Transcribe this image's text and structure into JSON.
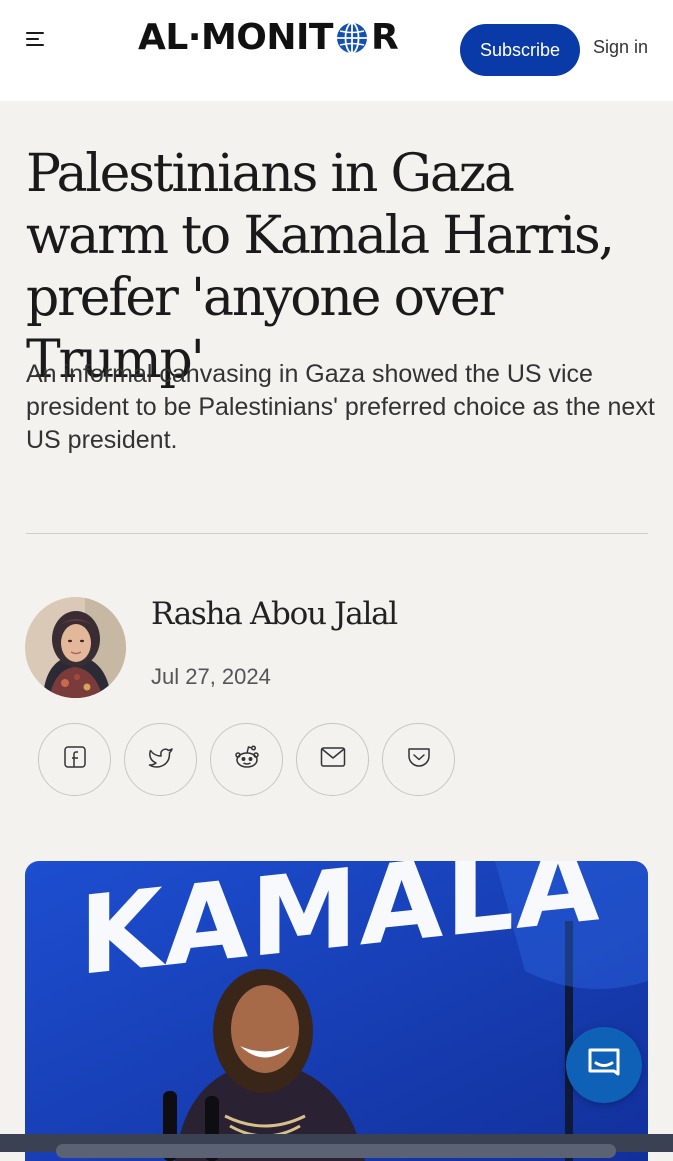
{
  "header": {
    "logo_text_left": "AL·MONIT",
    "logo_text_right": "R",
    "subscribe_label": "Subscribe",
    "signin_label": "Sign in",
    "menu_icon": "hamburger-menu-icon",
    "logo_globe_icon": "globe-icon"
  },
  "article": {
    "headline": "Palestinians in Gaza warm to Kamala Harris, prefer 'anyone over Trump'",
    "dek": "An informal canvasing in Gaza showed the US vice president to be Palestinians' preferred choice as the next US president.",
    "author": "Rasha Abou Jalal",
    "date": "Jul 27, 2024"
  },
  "share": [
    {
      "name": "facebook",
      "icon": "facebook-icon"
    },
    {
      "name": "twitter",
      "icon": "twitter-icon"
    },
    {
      "name": "reddit",
      "icon": "reddit-icon"
    },
    {
      "name": "email",
      "icon": "mail-icon"
    },
    {
      "name": "pocket",
      "icon": "pocket-icon"
    }
  ],
  "hero": {
    "banner_text": "KAMALA"
  },
  "chat_icon": "chat-bubble-icon",
  "colors": {
    "brand_blue": "#0a3aa8",
    "page_bg": "#f3f2ef",
    "hero_bg": "#1a47c9",
    "chat_blue": "#0f61b7"
  }
}
